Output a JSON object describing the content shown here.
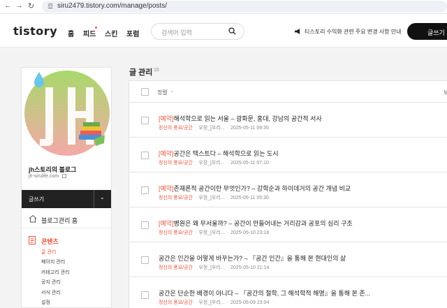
{
  "browser": {
    "url": "siru2479.tistory.com/manage/posts/",
    "back_icon": "←",
    "forward_icon": "→",
    "reload_icon": "↻",
    "site_info_icon": "☲"
  },
  "header": {
    "logo": "tistory",
    "nav": [
      "홈",
      "피드",
      "스킨",
      "포럼"
    ],
    "search_placeholder": "검색어 입력",
    "notice": "티스토리 수익화 관련 주요 변경 사항 안내",
    "write_label": "글쓰기"
  },
  "sidebar": {
    "blog_title": "jh스토리의 블로그",
    "blog_url": "jh-sirulife.com",
    "write_label": "글쓰기",
    "write_arrow": "⌄",
    "home_label": "블로그관리 홈",
    "content_label": "콘텐츠",
    "content_items": [
      "글 관리",
      "페이지 관리",
      "카테고리 관리",
      "공지 관리",
      "서식 관리",
      "설정"
    ]
  },
  "main": {
    "title": "글 관리",
    "count": "15",
    "sort_label": "정렬",
    "sort_icon": "⌄",
    "head_right": "보"
  },
  "posts": [
    {
      "tag": "[예약]",
      "title": "해석학으로 읽는 서울 – 광화문, 홍대, 강남의 공간적 서사",
      "category": "정신의 풍요/공간",
      "author": "우정_[우리...",
      "date": "2025-05-11 09:35"
    },
    {
      "tag": "[예약]",
      "title": "공간은 텍스트다 – 해석학으로 읽는 도시",
      "category": "정신의 풍요/공간",
      "author": "우정_[우리...",
      "date": "2025-05-11 07:10"
    },
    {
      "tag": "[예약]",
      "title": "존재론적 공간이란 무엇인가? – 강학순과 하이데거의 공간 개념 비교",
      "category": "정신의 풍요/공간",
      "author": "우정_[우리...",
      "date": "2025-05-11 05:30"
    },
    {
      "tag": "[예약]",
      "title": "병원은 왜 무서울까? – 공간이 만들어내는 거리감과 공포의 심리 구조",
      "category": "정신의 풍요/공간",
      "author": "우정_[우리...",
      "date": "2025-05-10 23:18"
    },
    {
      "tag": "",
      "title": "공간은 인간을 어떻게 바꾸는가? – 『공간 인간』을 통해 본 현대인의 삶",
      "category": "정신의 풍요/공간",
      "author": "우정_[우리...",
      "date": "2025-05-10 21:14"
    },
    {
      "tag": "",
      "title": "공간은 단순한 배경이 아니다 – 『공간의 철학, 그 해석학적 해명』을 통해 본 존...",
      "category": "정신의 풍요/공간",
      "author": "우정_[우리...",
      "date": "2025-05-09 23:04"
    }
  ],
  "colors": {
    "accent": "#e8533f",
    "dark": "#222222"
  }
}
